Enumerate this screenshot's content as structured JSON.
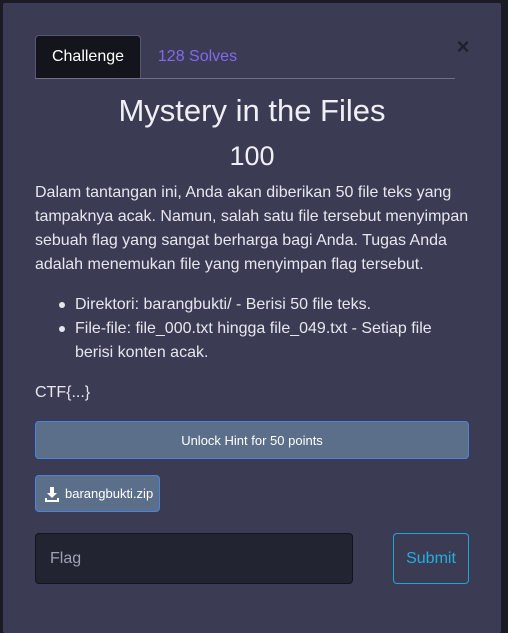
{
  "tabs": {
    "challenge_label": "Challenge",
    "solves_label": "128 Solves"
  },
  "close_label": "×",
  "challenge": {
    "title": "Mystery in the Files",
    "points": "100",
    "description": "Dalam tantangan ini, Anda akan diberikan 50 file teks yang tampaknya acak. Namun, salah satu file tersebut menyimpan sebuah flag yang sangat berharga bagi Anda. Tugas Anda adalah menemukan file yang menyimpan flag tersebut.",
    "bullets": [
      "Direktori: barangbukti/ - Berisi 50 file teks.",
      "File-file: file_000.txt hingga file_049.txt - Setiap file berisi konten acak."
    ],
    "flag_format": "CTF{...}"
  },
  "hint_button_label": "Unlock Hint for 50 points",
  "file_button": {
    "icon": "download-icon",
    "label": "barangbukti.zip"
  },
  "flag_input": {
    "placeholder": "Flag",
    "value": ""
  },
  "submit_label": "Submit",
  "colors": {
    "background": "#3b3c53",
    "active_tab": "#14141c",
    "solves_link": "#7f6bf0",
    "hint_button": "#5b6f8a",
    "submit_accent": "#23aee0"
  }
}
